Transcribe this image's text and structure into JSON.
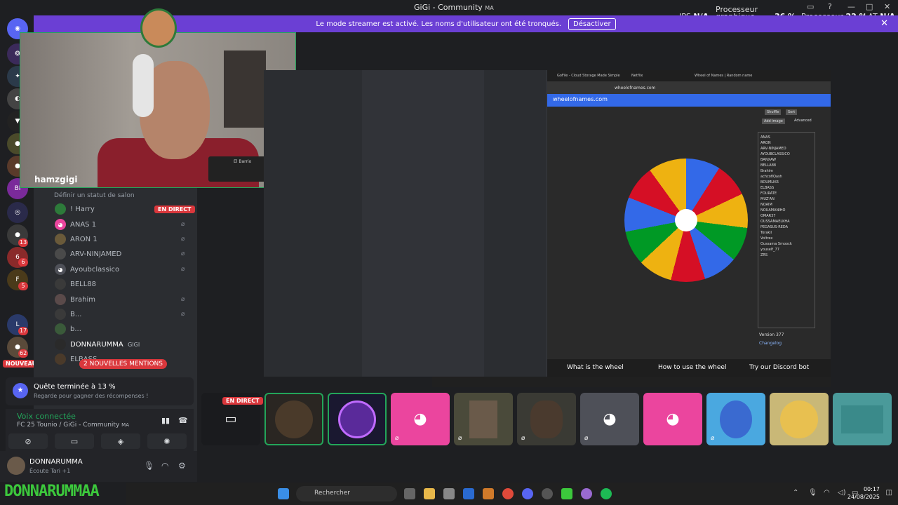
{
  "window": {
    "title": "GiGi - Community",
    "title_suffix": "MA"
  },
  "stats": {
    "ips_label": "IPS",
    "ips_value": "N/A",
    "gpu_label": "Processeur graphique",
    "gpu_value": "36 %",
    "cpu_label": "Processeur",
    "cpu_value": "22 %",
    "lat_label": "LAT",
    "lat_value": "N/A"
  },
  "banner": {
    "text": "Le mode streamer est activé. Les noms d'utilisateur ont été tronqués.",
    "button": "Désactiver"
  },
  "guild_badges": [
    "13",
    "6",
    "5",
    "17",
    "62",
    "114"
  ],
  "sidebar": {
    "status_hint": "Définir un statut de salon",
    "live_label": "EN DIRECT",
    "members": [
      "! Harry",
      "ANAS 1",
      "ARON 1",
      "ARV-NINJAMED",
      "Ayoubclassico",
      "BELL88",
      "Brahim",
      "B...",
      "b...",
      "DONNARUMMA",
      "ELBASS",
      "FOURATE"
    ],
    "donnarumma_tag": "GIGI",
    "mentions": "2 NOUVELLES MENTIONS",
    "nouveau": "NOUVEAU"
  },
  "quest": {
    "title": "Quête terminée à 13 %",
    "subtitle": "Regarde pour gagner des récompenses !"
  },
  "voice": {
    "status": "Voix connectée",
    "channel": "FC 25 Tounio / GiGi - Community",
    "channel_suffix": "MA"
  },
  "user": {
    "name": "DONNARUMMA",
    "status": "Écoute Tari +1"
  },
  "camera": {
    "streamer_name": "hamzgigi",
    "mini_song": "El Barrio"
  },
  "browser": {
    "tabs": [
      "GoFile - Cloud Storage Made Simple",
      "Netflix",
      "Wheel of Names | Random name"
    ],
    "url": "wheelofnames.com",
    "site": "wheelofnames.com",
    "shuffle": "Shuffle",
    "sort": "Sort",
    "add_image": "Add image",
    "advanced": "Advanced",
    "names": [
      "ANAS",
      "ARON",
      "ARV-NINJAMED",
      "AYOUBCLASSICO",
      "BANXAW",
      "BELLA88",
      "Brahim",
      "achcoflQash",
      "BOUMLIK6",
      "ELBASS",
      "FOURATE",
      "MUZ'AN",
      "NOAIM",
      "NOUAMANIHO",
      "OMAR37",
      "OUSSAMAELKHA",
      "PEGASUS-REDA",
      "Torakil",
      "Voltrex",
      "Oussama Smoock",
      "youself_77",
      "ZRS"
    ],
    "version": "Version 377",
    "changelog": "Changelog",
    "bottom": [
      "What is the wheel",
      "How to use the wheel",
      "Try our Discord bot"
    ]
  },
  "live_tile_label": "EN DIRECT",
  "taskbar": {
    "search": "Rechercher",
    "time": "00:17",
    "date": "24/08/2025"
  },
  "watermark": "DONNARUMMAA",
  "colors": {
    "brand": "#5865f2",
    "banner": "#6b3fd4",
    "live": "#da373c",
    "online": "#23a55a",
    "watermark": "#3cc83c"
  }
}
